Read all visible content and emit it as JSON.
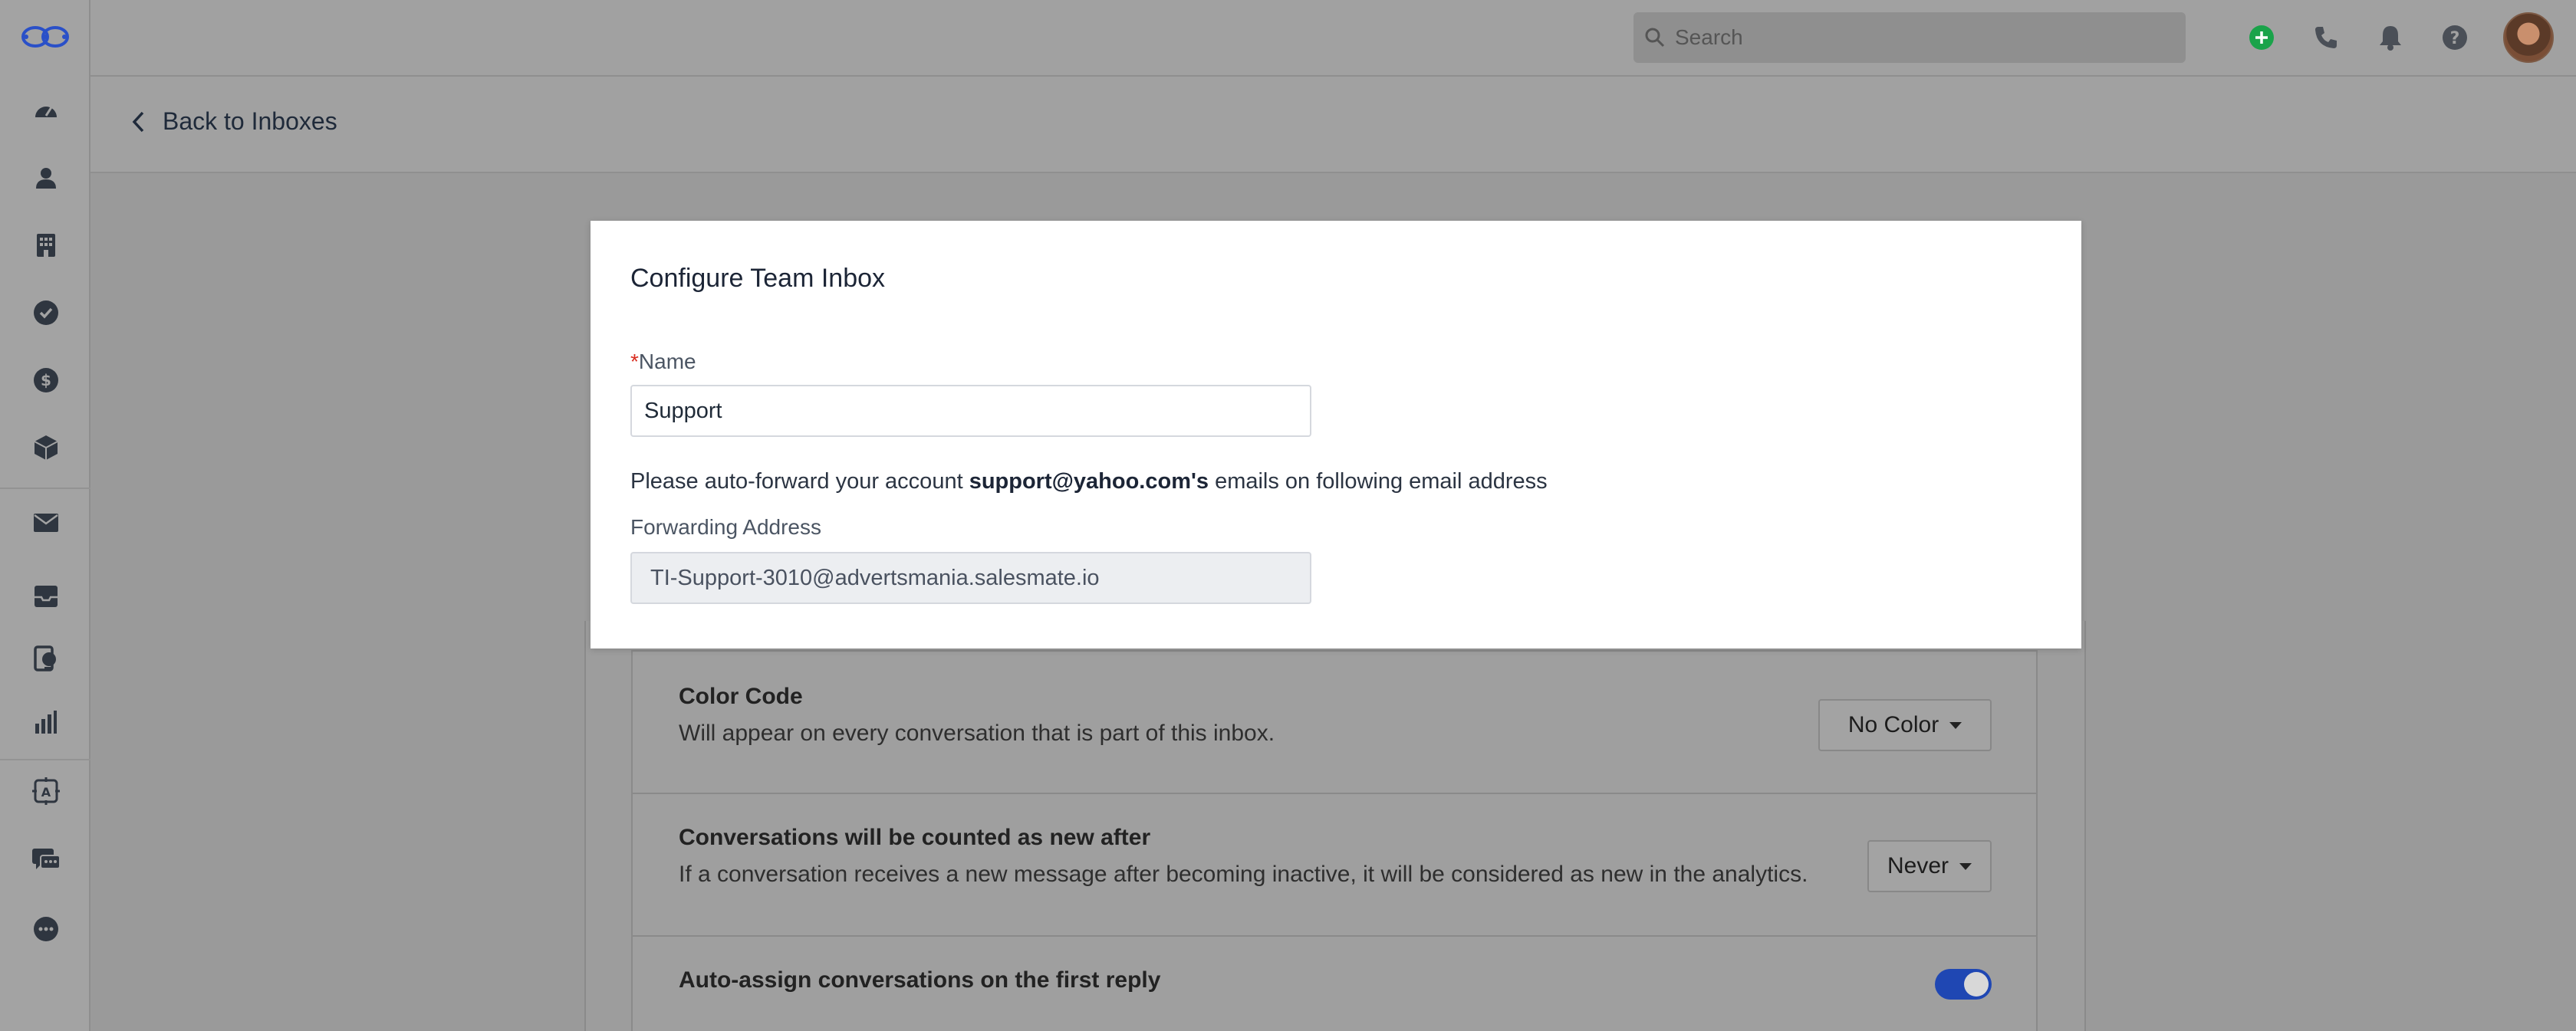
{
  "topbar": {
    "search_placeholder": "Search"
  },
  "subheader": {
    "back_label": "Back to Inboxes"
  },
  "modal": {
    "title": "Configure Team Inbox",
    "name_required_mark": "*",
    "name_label": "Name",
    "name_value": "Support",
    "info_prefix": "Please auto-forward your account ",
    "info_account": "support@yahoo.com's",
    "info_suffix": " emails on following email address",
    "forwarding_label": "Forwarding Address",
    "forwarding_value": "TI-Support-3010@advertsmania.salesmate.io"
  },
  "settings": {
    "color_code": {
      "title": "Color Code",
      "description": "Will appear on every conversation that is part of this inbox.",
      "selected": "No Color"
    },
    "conversations_new": {
      "title": "Conversations will be counted as new after",
      "description": "If a conversation receives a new message after becoming inactive, it will be considered as new in the analytics.",
      "selected": "Never"
    },
    "auto_assign": {
      "title": "Auto-assign conversations on the first reply",
      "enabled": true
    }
  },
  "colors": {
    "accent": "#1f47b3",
    "add_button": "#1aa34a",
    "required": "#d92d20"
  },
  "icons": {
    "sidebar": [
      "dashboard-icon",
      "contacts-icon",
      "companies-icon",
      "tasks-icon",
      "deals-icon",
      "products-icon",
      "email-icon",
      "inbox-icon",
      "sequences-icon",
      "reports-icon",
      "automation-icon",
      "chat-icon",
      "more-icon"
    ],
    "topbar": [
      "add-icon",
      "phone-icon",
      "bell-icon",
      "help-icon"
    ]
  }
}
